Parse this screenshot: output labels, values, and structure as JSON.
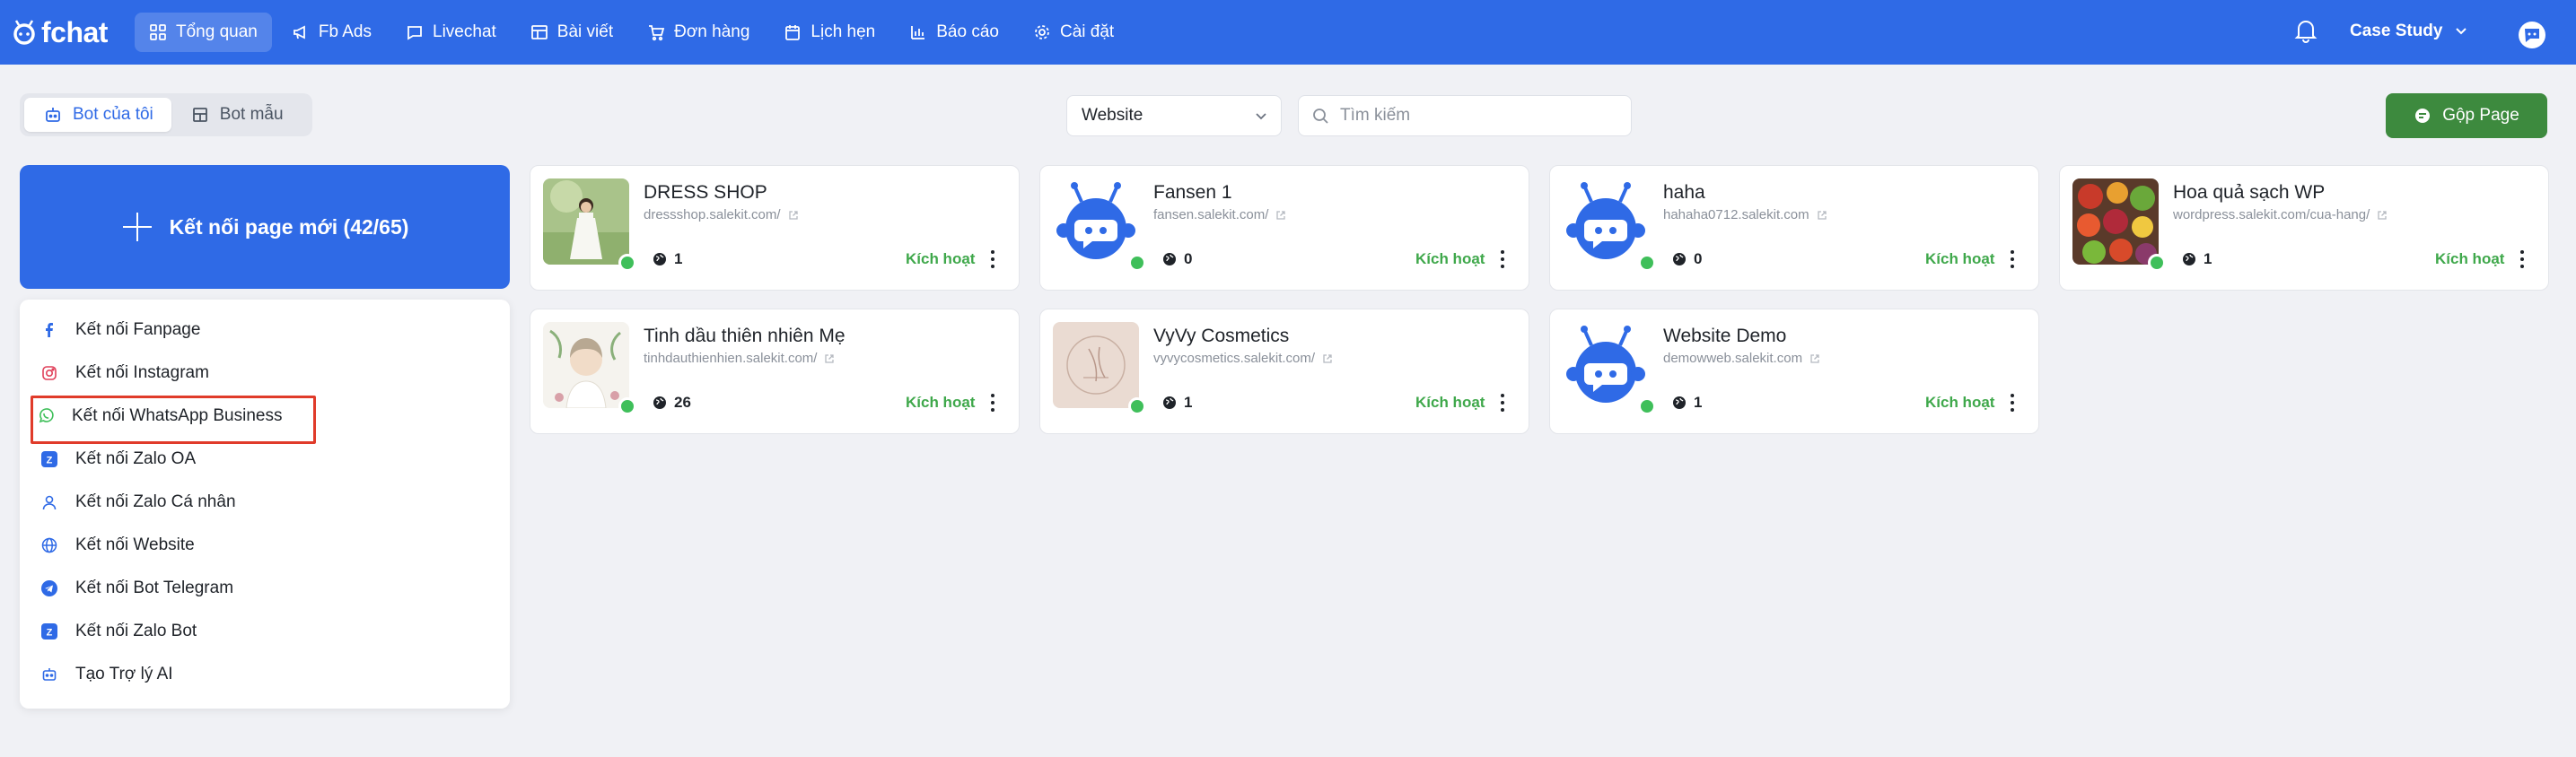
{
  "app": {
    "name": "fchat",
    "brand_color": "#2f6ae6"
  },
  "nav": {
    "items": [
      {
        "label": "Tổng quan",
        "icon": "dashboard-icon",
        "active": true
      },
      {
        "label": "Fb Ads",
        "icon": "megaphone-icon"
      },
      {
        "label": "Livechat",
        "icon": "chat-icon"
      },
      {
        "label": "Bài viết",
        "icon": "layout-icon"
      },
      {
        "label": "Đơn hàng",
        "icon": "cart-icon"
      },
      {
        "label": "Lịch hẹn",
        "icon": "calendar-icon"
      },
      {
        "label": "Báo cáo",
        "icon": "bar-chart-icon"
      },
      {
        "label": "Cài đặt",
        "icon": "gear-icon"
      }
    ],
    "account": "Case Study"
  },
  "toolbar": {
    "tabs": [
      {
        "label": "Bot của tôi",
        "active": true
      },
      {
        "label": "Bot mẫu",
        "active": false
      }
    ],
    "filter_value": "Website",
    "search_placeholder": "Tìm kiếm",
    "merge_label": "Gộp Page",
    "merge_color": "#3d8a3e"
  },
  "connect": {
    "button_label": "Kết nối page mới (42/65)",
    "menu": [
      {
        "label": "Kết nối Fanpage",
        "icon": "facebook-icon"
      },
      {
        "label": "Kết nối Instagram",
        "icon": "instagram-icon"
      },
      {
        "label": "Kết nối WhatsApp Business",
        "icon": "whatsapp-icon",
        "highlighted": true
      },
      {
        "label": "Kết nối Zalo OA",
        "icon": "zalo-icon"
      },
      {
        "label": "Kết nối Zalo Cá nhân",
        "icon": "user-icon"
      },
      {
        "label": "Kết nối Website",
        "icon": "globe-icon"
      },
      {
        "label": "Kết nối Bot Telegram",
        "icon": "telegram-icon"
      },
      {
        "label": "Kết nối Zalo Bot",
        "icon": "zalo-icon"
      },
      {
        "label": "Tạo Trợ lý AI",
        "icon": "bot-icon"
      }
    ],
    "highlight_color": "#e03b2a"
  },
  "pages": [
    {
      "name": "DRESS SHOP",
      "url": "dressshop.salekit.com/",
      "count": "1",
      "status": "Kích hoạt",
      "thumb": "photo-dress"
    },
    {
      "name": "Fansen 1",
      "url": "fansen.salekit.com/",
      "count": "0",
      "status": "Kích hoạt",
      "thumb": "robot"
    },
    {
      "name": "haha",
      "url": "hahaha0712.salekit.com",
      "count": "0",
      "status": "Kích hoạt",
      "thumb": "robot"
    },
    {
      "name": "Hoa quả sạch WP",
      "url": "wordpress.salekit.com/cua-hang/",
      "count": "1",
      "status": "Kích hoạt",
      "thumb": "photo-fruit"
    },
    {
      "name": "Tinh dầu thiên nhiên Mẹ",
      "url": "tinhdauthienhien.salekit.com/",
      "count": "26",
      "status": "Kích hoạt",
      "thumb": "photo-oil"
    },
    {
      "name": "VyVy Cosmetics",
      "url": "vyvycosmetics.salekit.com/",
      "count": "1",
      "status": "Kích hoạt",
      "thumb": "photo-cosmetics"
    },
    {
      "name": "Website Demo",
      "url": "demowweb.salekit.com",
      "count": "1",
      "status": "Kích hoạt",
      "thumb": "robot"
    }
  ],
  "status_color": "#3fa84b"
}
